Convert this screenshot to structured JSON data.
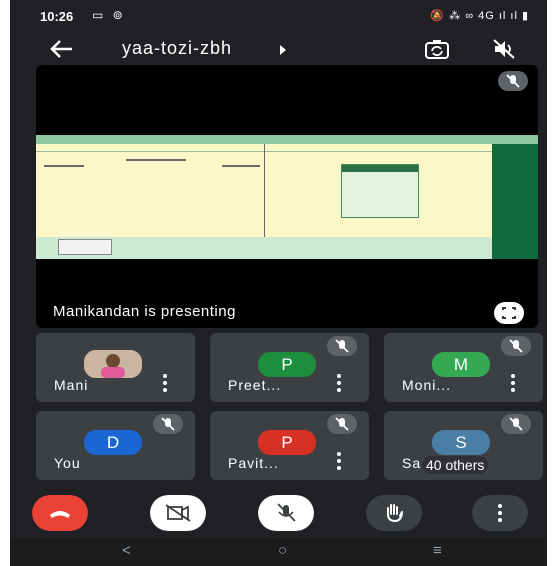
{
  "status_bar": {
    "time": "10:26",
    "left_icons": "▭ ⊚",
    "right_icons": "🔕 ⁂ ∞ 4G ıl ıl ▮"
  },
  "header": {
    "back_icon": "arrow-left",
    "meeting_code": "yaa-tozi-zbh",
    "camera_switch_icon": "camera-flip",
    "speaker_icon": "speaker-off"
  },
  "presentation": {
    "presenter_label": "Manikandan is presenting",
    "mic_status": "muted",
    "fullscreen_icon": "fullscreen"
  },
  "participants": [
    {
      "name": "Mani",
      "initial": "",
      "avatar_color": "",
      "has_photo": true,
      "muted": false
    },
    {
      "name": "Preet...",
      "initial": "P",
      "avatar_color": "#1e8e3e",
      "has_photo": false,
      "muted": true
    },
    {
      "name": "Moni...",
      "initial": "M",
      "avatar_color": "#34a853",
      "has_photo": false,
      "muted": true
    },
    {
      "name": "You",
      "initial": "D",
      "avatar_color": "#1967d2",
      "has_photo": false,
      "muted": true
    },
    {
      "name": "Pavit...",
      "initial": "P",
      "avatar_color": "#d93025",
      "has_photo": false,
      "muted": true
    },
    {
      "name": "Sa",
      "initial": "S",
      "avatar_color": "#4a7fa5",
      "has_photo": false,
      "muted": true,
      "others_label": "40 others"
    }
  ],
  "controls": {
    "end_call_color": "#ea4335",
    "camera": "off",
    "mic": "off",
    "raise_hand_icon": "hand",
    "more_icon": "more-vert"
  },
  "nav_bar": {
    "back": "<",
    "home": "○",
    "recents": "≡"
  }
}
